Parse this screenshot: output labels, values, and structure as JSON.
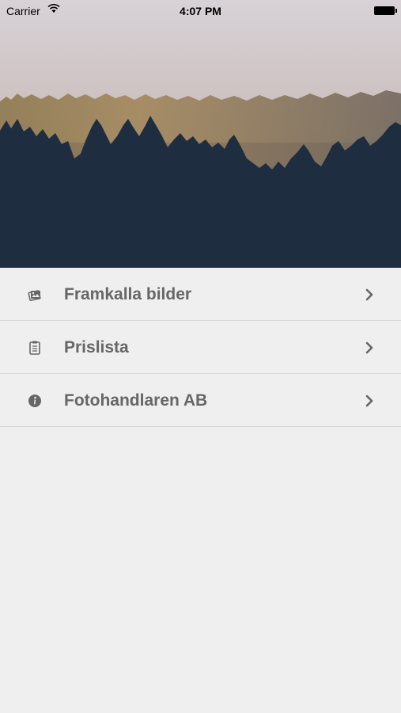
{
  "status_bar": {
    "carrier": "Carrier",
    "time": "4:07 PM"
  },
  "menu": {
    "items": [
      {
        "label": "Framkalla bilder",
        "icon": "photos-icon"
      },
      {
        "label": "Prislista",
        "icon": "clipboard-icon"
      },
      {
        "label": "Fotohandlaren AB",
        "icon": "info-icon"
      }
    ]
  },
  "colors": {
    "background": "#efefef",
    "label": "#666666",
    "icon": "#666666",
    "divider": "#d6d6d6",
    "forest": "#1e2d3f"
  }
}
